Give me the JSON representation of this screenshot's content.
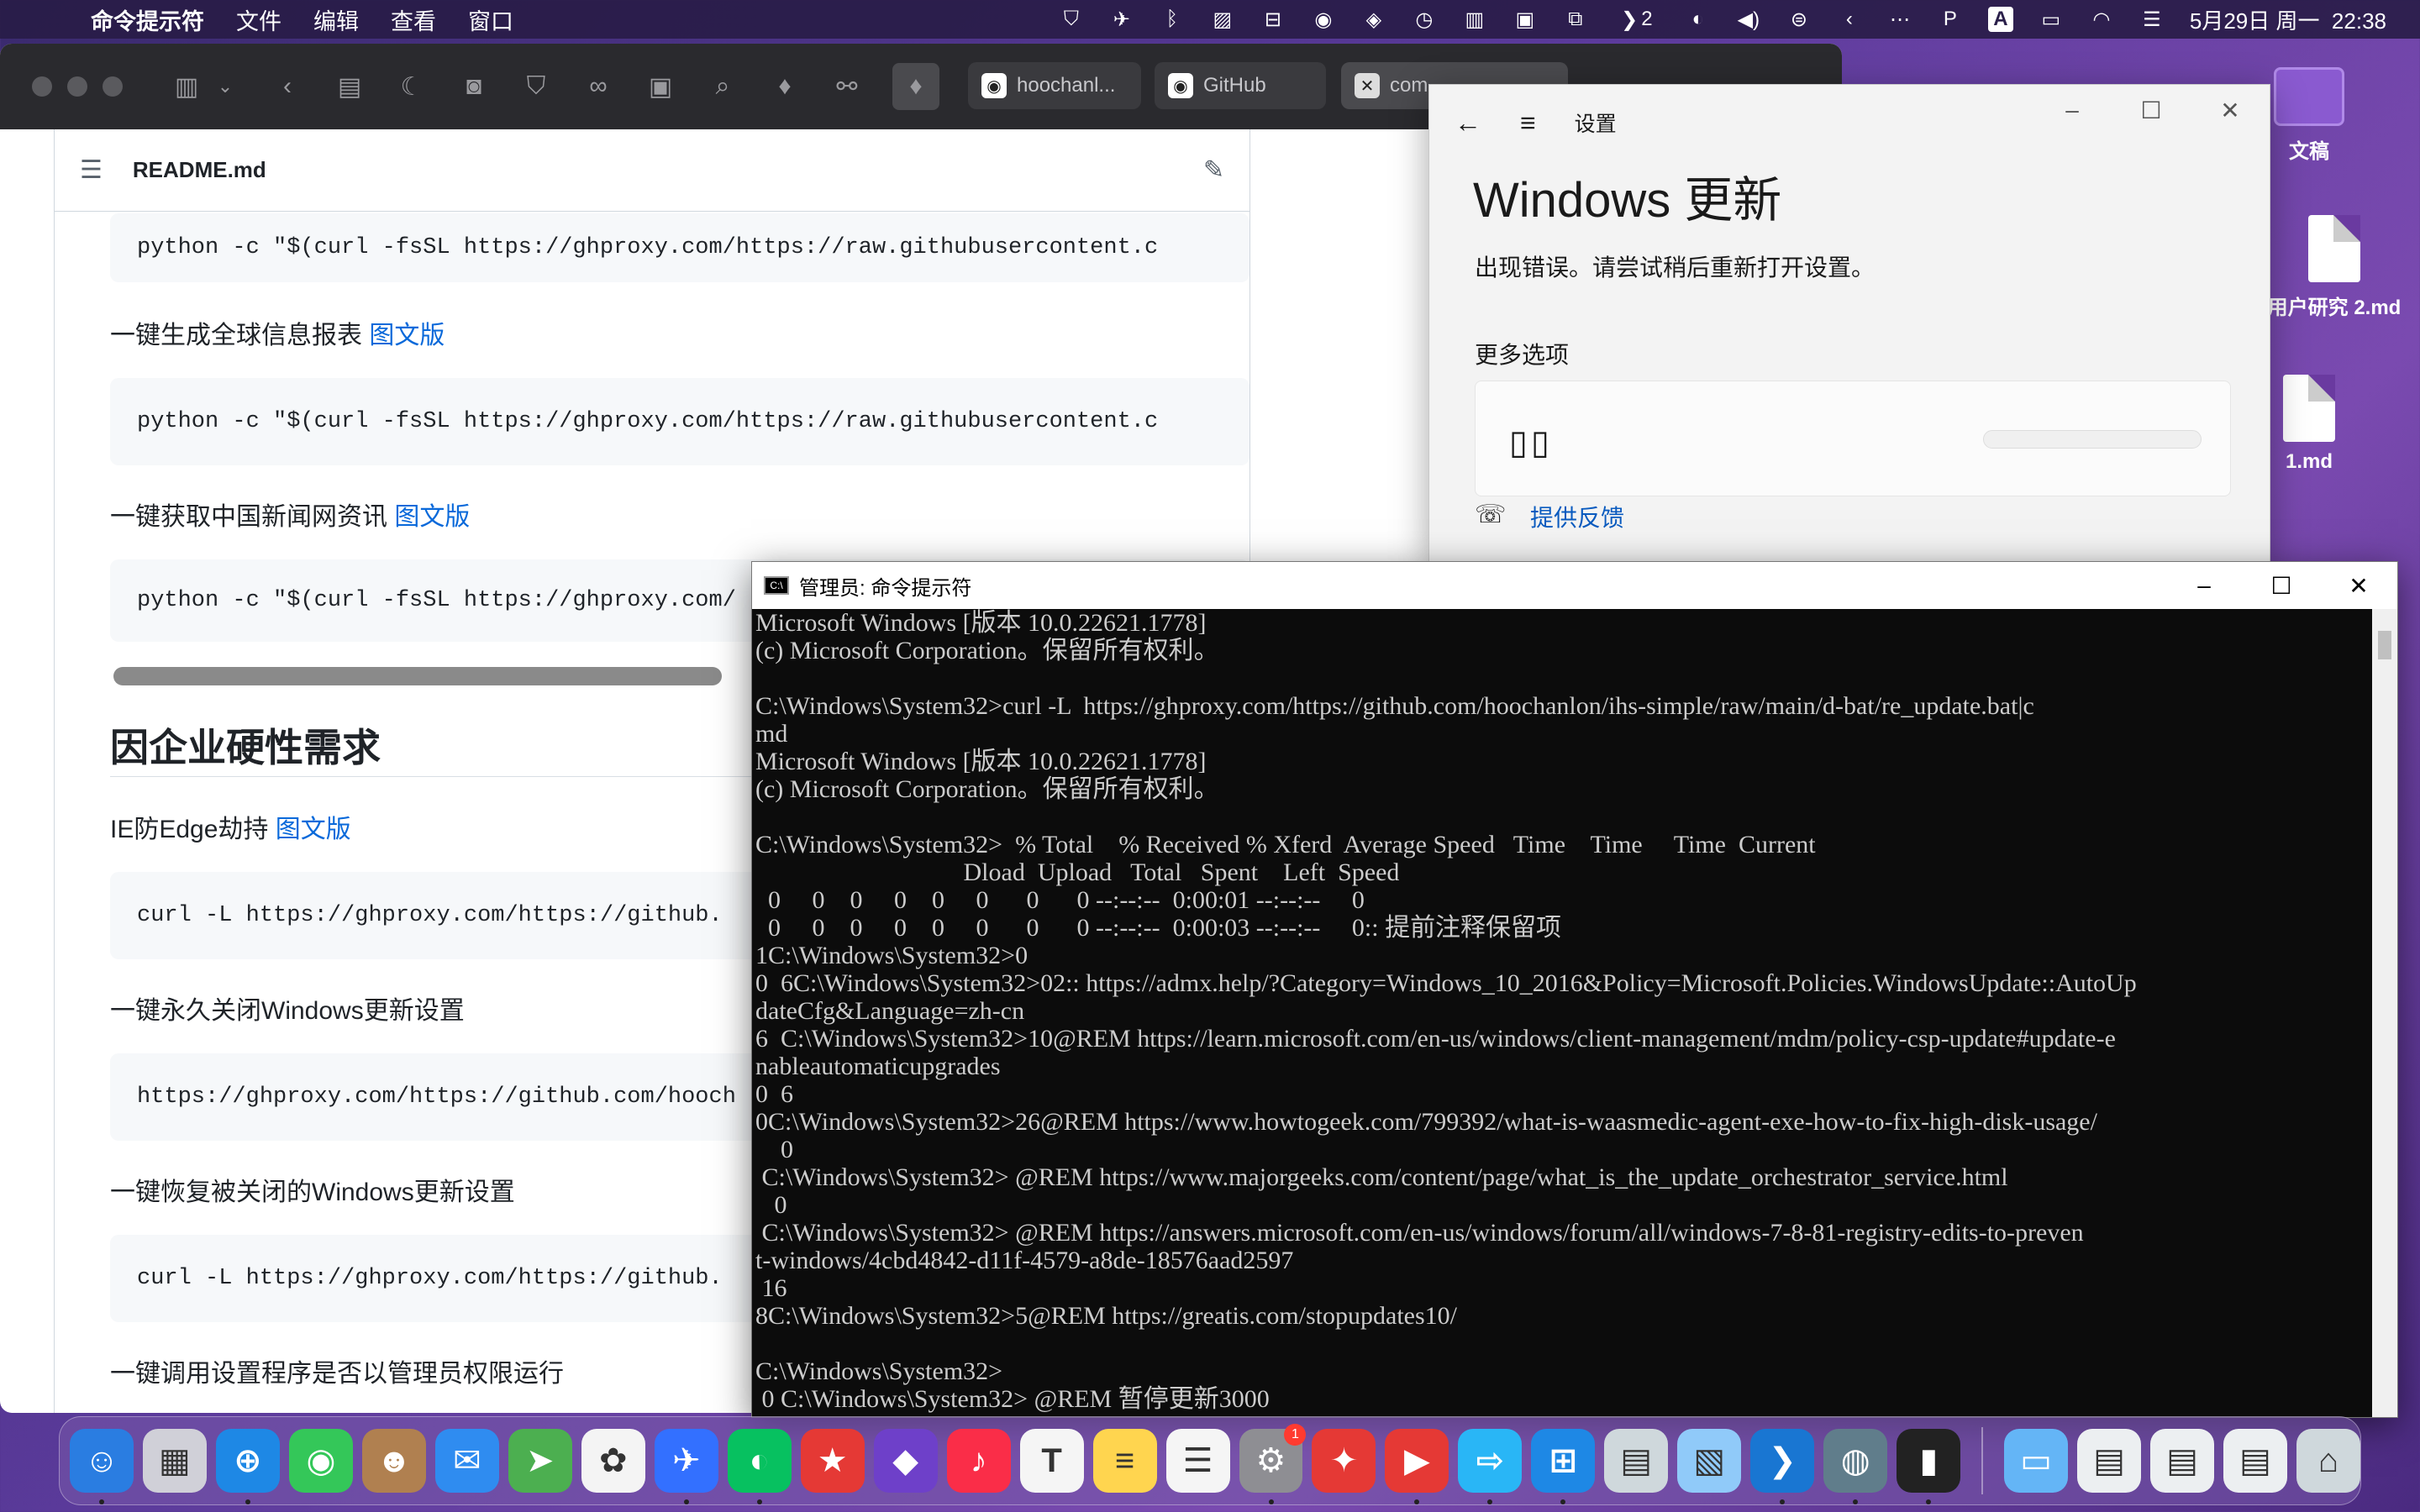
{
  "menubar": {
    "app_name": "命令提示符",
    "menus": [
      "文件",
      "编辑",
      "查看",
      "窗口"
    ],
    "badge_count": "2",
    "datetime": "5月29日 周一  22:38"
  },
  "desktop": {
    "items": [
      {
        "label": "文稿",
        "icon": "folder-icon"
      },
      {
        "label": "用户研究 2.md",
        "icon": "markdown-file-icon"
      },
      {
        "label": "1.md",
        "icon": "markdown-file-icon"
      }
    ]
  },
  "browser": {
    "tabs": [
      {
        "label": "hoochanl...",
        "icon": "github-icon"
      },
      {
        "label": "GitHub",
        "icon": "github-icon"
      },
      {
        "label": "com",
        "icon": "close-icon"
      }
    ],
    "readme": {
      "filename": "README.md",
      "blocks": [
        {
          "kind": "code",
          "text": "python -c \"$(curl -fsSL https://ghproxy.com/https://raw.githubusercontent.c"
        },
        {
          "kind": "para",
          "text": "一键生成全球信息报表 ",
          "link": "图文版"
        },
        {
          "kind": "code",
          "text": "python -c \"$(curl -fsSL https://ghproxy.com/https://raw.githubusercontent.c"
        },
        {
          "kind": "para",
          "text": "一键获取中国新闻网资讯 ",
          "link": "图文版"
        },
        {
          "kind": "code",
          "text": "python -c \"$(curl -fsSL https://ghproxy.com/"
        },
        {
          "kind": "heading",
          "text": "因企业硬性需求"
        },
        {
          "kind": "para",
          "text": "IE防Edge劫持 ",
          "link": "图文版"
        },
        {
          "kind": "code",
          "text": "curl -L  https://ghproxy.com/https://github."
        },
        {
          "kind": "para",
          "text": "一键永久关闭Windows更新设置",
          "link": ""
        },
        {
          "kind": "code",
          "text": "https://ghproxy.com/https://github.com/hooch"
        },
        {
          "kind": "para",
          "text": "一键恢复被关闭的Windows更新设置",
          "link": ""
        },
        {
          "kind": "code",
          "text": "curl -L  https://ghproxy.com/https://github."
        },
        {
          "kind": "para",
          "text": "一键调用设置程序是否以管理员权限运行",
          "link": ""
        }
      ]
    }
  },
  "settings_window": {
    "title": "设置",
    "heading": "Windows 更新",
    "error": "出现错误。请尝试稍后重新打开设置。",
    "more_options": "更多选项",
    "pause_glyph": "▯▯",
    "feedback": "提供反馈"
  },
  "cmd_window": {
    "title": "管理员: 命令提示符",
    "lines": [
      "Microsoft Windows [版本 10.0.22621.1778]",
      "(c) Microsoft Corporation。保留所有权利。",
      "",
      "C:\\Windows\\System32>curl -L  https://ghproxy.com/https://github.com/hoochanlon/ihs-simple/raw/main/d-bat/re_update.bat|c",
      "md",
      "Microsoft Windows [版本 10.0.22621.1778]",
      "(c) Microsoft Corporation。保留所有权利。",
      "",
      "C:\\Windows\\System32>  % Total    % Received % Xferd  Average Speed   Time    Time     Time  Current",
      "                                 Dload  Upload   Total   Spent    Left  Speed",
      "  0     0    0     0    0     0      0      0 --:--:--  0:00:01 --:--:--     0",
      "  0     0    0     0    0     0      0      0 --:--:--  0:00:03 --:--:--     0:: 提前注释保留项",
      "1C:\\Windows\\System32>0",
      "0  6C:\\Windows\\System32>02:: https://admx.help/?Category=Windows_10_2016&Policy=Microsoft.Policies.WindowsUpdate::AutoUp",
      "dateCfg&Language=zh-cn",
      "6  C:\\Windows\\System32>10@REM https://learn.microsoft.com/en-us/windows/client-management/mdm/policy-csp-update#update-e",
      "nableautomaticupgrades",
      "0  6",
      "0C:\\Windows\\System32>26@REM https://www.howtogeek.com/799392/what-is-waasmedic-agent-exe-how-to-fix-high-disk-usage/",
      "    0",
      " C:\\Windows\\System32> @REM https://www.majorgeeks.com/content/page/what_is_the_update_orchestrator_service.html",
      "   0",
      " C:\\Windows\\System32> @REM https://answers.microsoft.com/en-us/windows/forum/all/windows-7-8-81-registry-edits-to-preven",
      "t-windows/4cbd4842-d11f-4579-a8de-18576aad2597",
      " 16",
      "8C:\\Windows\\System32>5@REM https://greatis.com/stopupdates10/",
      "",
      "C:\\Windows\\System32>",
      " 0 C:\\Windows\\System32> @REM 暂停更新3000"
    ]
  },
  "dock": {
    "badge": "1",
    "apps": [
      {
        "name": "finder",
        "color": "#2a7de1",
        "glyph": "☺"
      },
      {
        "name": "launchpad",
        "color": "#d0d0d8",
        "glyph": "▦"
      },
      {
        "name": "safari",
        "color": "#1e88e5",
        "glyph": "⊕"
      },
      {
        "name": "messages",
        "color": "#34c759",
        "glyph": "◉"
      },
      {
        "name": "contacts",
        "color": "#b08050",
        "glyph": "☻"
      },
      {
        "name": "mail",
        "color": "#2f8cf0",
        "glyph": "✉"
      },
      {
        "name": "maps",
        "color": "#4caf50",
        "glyph": "➤"
      },
      {
        "name": "photos",
        "color": "#f4f4f4",
        "glyph": "✿"
      },
      {
        "name": "feishu",
        "color": "#3370ff",
        "glyph": "✈"
      },
      {
        "name": "wechat",
        "color": "#07c160",
        "glyph": "◐"
      },
      {
        "name": "bookmark-app",
        "color": "#e53935",
        "glyph": "★"
      },
      {
        "name": "github-desktop",
        "color": "#6e40c9",
        "glyph": "◆"
      },
      {
        "name": "music",
        "color": "#fa2d48",
        "glyph": "♪"
      },
      {
        "name": "typora",
        "color": "#f5f5f5",
        "glyph": "T"
      },
      {
        "name": "notes",
        "color": "#ffd54f",
        "glyph": "≡"
      },
      {
        "name": "reminders",
        "color": "#f5f5f5",
        "glyph": "☰"
      },
      {
        "name": "system-settings",
        "color": "#8e8e93",
        "glyph": "⚙"
      },
      {
        "name": "xmind",
        "color": "#e53935",
        "glyph": "✦"
      },
      {
        "name": "pdf-expert",
        "color": "#e53935",
        "glyph": "▶"
      },
      {
        "name": "screen-share",
        "color": "#29b6f6",
        "glyph": "⇨"
      },
      {
        "name": "windows-app",
        "color": "#1e88e5",
        "glyph": "⊞"
      },
      {
        "name": "scanner",
        "color": "#cfd8dc",
        "glyph": "▤"
      },
      {
        "name": "preview",
        "color": "#90caf9",
        "glyph": "▧"
      },
      {
        "name": "vscode",
        "color": "#1976d2",
        "glyph": "❯"
      },
      {
        "name": "system-preferences",
        "color": "#607d8b",
        "glyph": "◍"
      },
      {
        "name": "terminal",
        "color": "#222222",
        "glyph": "▮"
      }
    ],
    "right_items": [
      {
        "name": "downloads-folder",
        "color": "#64b5f6",
        "glyph": "▭"
      },
      {
        "name": "recent-doc-1",
        "color": "#eceff1",
        "glyph": "▤"
      },
      {
        "name": "recent-doc-2",
        "color": "#eceff1",
        "glyph": "▤"
      },
      {
        "name": "recent-doc-3",
        "color": "#eceff1",
        "glyph": "▤"
      },
      {
        "name": "trash",
        "color": "#cfd8dc",
        "glyph": "⌂"
      }
    ]
  }
}
